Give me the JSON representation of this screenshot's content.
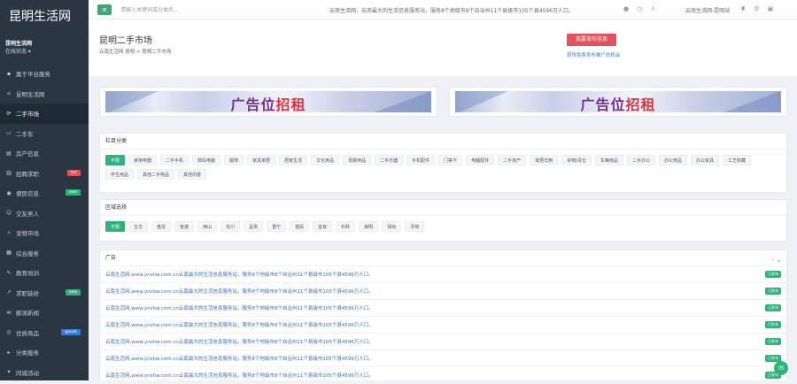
{
  "sidebar": {
    "logo": "昆明生活网",
    "user_name": "昆明生活网",
    "user_status": "在线状态 ▾",
    "items": [
      {
        "label": "属于平台服务",
        "icon": "▪",
        "icon_name": "menu-icon",
        "badge": ""
      },
      {
        "label": "昆明生活网",
        "icon": "⌂",
        "icon_name": "home-icon",
        "badge": ""
      },
      {
        "label": "二手市场",
        "icon": "⟳",
        "icon_name": "recycle-icon",
        "badge": ""
      },
      {
        "label": "二手车",
        "icon": "▭",
        "icon_name": "car-icon",
        "badge": ""
      },
      {
        "label": "房产信息",
        "icon": "▤",
        "icon_name": "building-icon",
        "badge": ""
      },
      {
        "label": "招聘求职",
        "icon": "▥",
        "icon_name": "briefcase-icon",
        "badge": "hot"
      },
      {
        "label": "便民信息",
        "icon": "◉",
        "icon_name": "info-icon",
        "badge": "new"
      },
      {
        "label": "交友男人",
        "icon": "☺",
        "icon_name": "user-icon",
        "badge": ""
      },
      {
        "label": "宠物市场",
        "icon": "✧",
        "icon_name": "paw-icon",
        "badge": ""
      },
      {
        "label": "综合服务",
        "icon": "▦",
        "icon_name": "service-icon",
        "badge": ""
      },
      {
        "label": "教育培训",
        "icon": "✎",
        "icon_name": "education-icon",
        "badge": ""
      },
      {
        "label": "求职装修",
        "icon": "↗",
        "icon_name": "decor-icon",
        "badge": "new"
      },
      {
        "label": "解读新闻",
        "icon": "≪",
        "icon_name": "share-icon",
        "badge": ""
      },
      {
        "label": "优质商品",
        "icon": "◎",
        "icon_name": "shop-icon",
        "badge": "goods"
      },
      {
        "label": "分类服务",
        "icon": "▸",
        "icon_name": "category-icon",
        "badge": ""
      },
      {
        "label": "同城活动",
        "icon": "✦",
        "icon_name": "activity-icon",
        "badge": ""
      }
    ]
  },
  "topbar": {
    "menu_icon": "≡",
    "search_placeholder": "请输入关键词或分类名...",
    "notice": "云南生活网，云南最大的生活信息服务站，服务8个地级市8个自治州11个县级市105个县4596万人口。",
    "icons": [
      "●",
      "◷",
      "♙"
    ],
    "user": "云南生活网-昆明站",
    "right_icons": [
      "♜",
      "⚙",
      "▣"
    ]
  },
  "header": {
    "title": "昆明二手市场",
    "breadcrumb": "云南生活网 昆明 > 昆明二手市场",
    "post_button": "我要发布信息",
    "post_link": "获得免费发布推广的机会"
  },
  "ads": [
    {
      "label": "广告位招租",
      "hl": "招租"
    },
    {
      "label": "广告位招租",
      "hl": "招租"
    }
  ],
  "categories": {
    "title": "栏目分类",
    "tags": [
      "不限",
      "家用电器",
      "二手手机",
      "数码电脑",
      "服饰",
      "家具家居",
      "居家生活",
      "文化用品",
      "母婴用品",
      "二手乐器",
      "手机配件",
      "门禁卡",
      "电脑配件",
      "二手房产",
      "家居日用",
      "杂物/清仓",
      "车辆用品",
      "二手办公",
      "办公用品",
      "办公家具",
      "工艺收藏",
      "学生用品",
      "其他二手物品",
      "其他闲置"
    ]
  },
  "regions": {
    "title": "区域选择",
    "tags": [
      "不限",
      "五华",
      "盘龙",
      "官渡",
      "西山",
      "东川",
      "呈贡",
      "晋宁",
      "富民",
      "宜良",
      "石林",
      "嵩明",
      "禄劝",
      "寻甸"
    ]
  },
  "listing": {
    "title": "广告",
    "collapse": "⌃ ×",
    "rows": [
      {
        "text": "云南生活网,www.ynshw.com.cn云南最大的生活信息服务站，服务8个地级市8个自治州11个县级市105个县4596万人口。",
        "status": "已发布"
      },
      {
        "text": "云南生活网,www.ynshw.com.cn云南最大的生活信息服务站，服务8个地级市8个自治州11个县级市105个县4596万人口。",
        "status": "已发布"
      },
      {
        "text": "云南生活网,www.ynshw.com.cn云南最大的生活信息服务站，服务8个地级市8个自治州11个县级市105个县4596万人口。",
        "status": "已发布"
      },
      {
        "text": "云南生活网,www.ynshw.com.cn云南最大的生活信息服务站，服务8个地级市8个自治州11个县级市105个县4596万人口。",
        "status": "已发布"
      },
      {
        "text": "云南生活网,www.ynshw.com.cn云南最大的生活信息服务站，服务8个地级市8个自治州11个县级市105个县4596万人口。",
        "status": "已发布"
      },
      {
        "text": "云南生活网,www.ynshw.com.cn云南最大的生活信息服务站，服务8个地级市8个自治州11个县级市105个县4596万人口。",
        "status": "已发布"
      },
      {
        "text": "云南生活网,www.ynshw.com.cn云南最大的生活信息服务站，服务8个地级市8个自治州11个县级市105个县4596万人口。",
        "status": "已发布"
      }
    ]
  },
  "float_icon": "✉",
  "colors": {
    "accent": "#2eb37b",
    "sidebar_bg": "#2b3643",
    "post_button": "#e55060",
    "link": "#3a6fb5"
  }
}
